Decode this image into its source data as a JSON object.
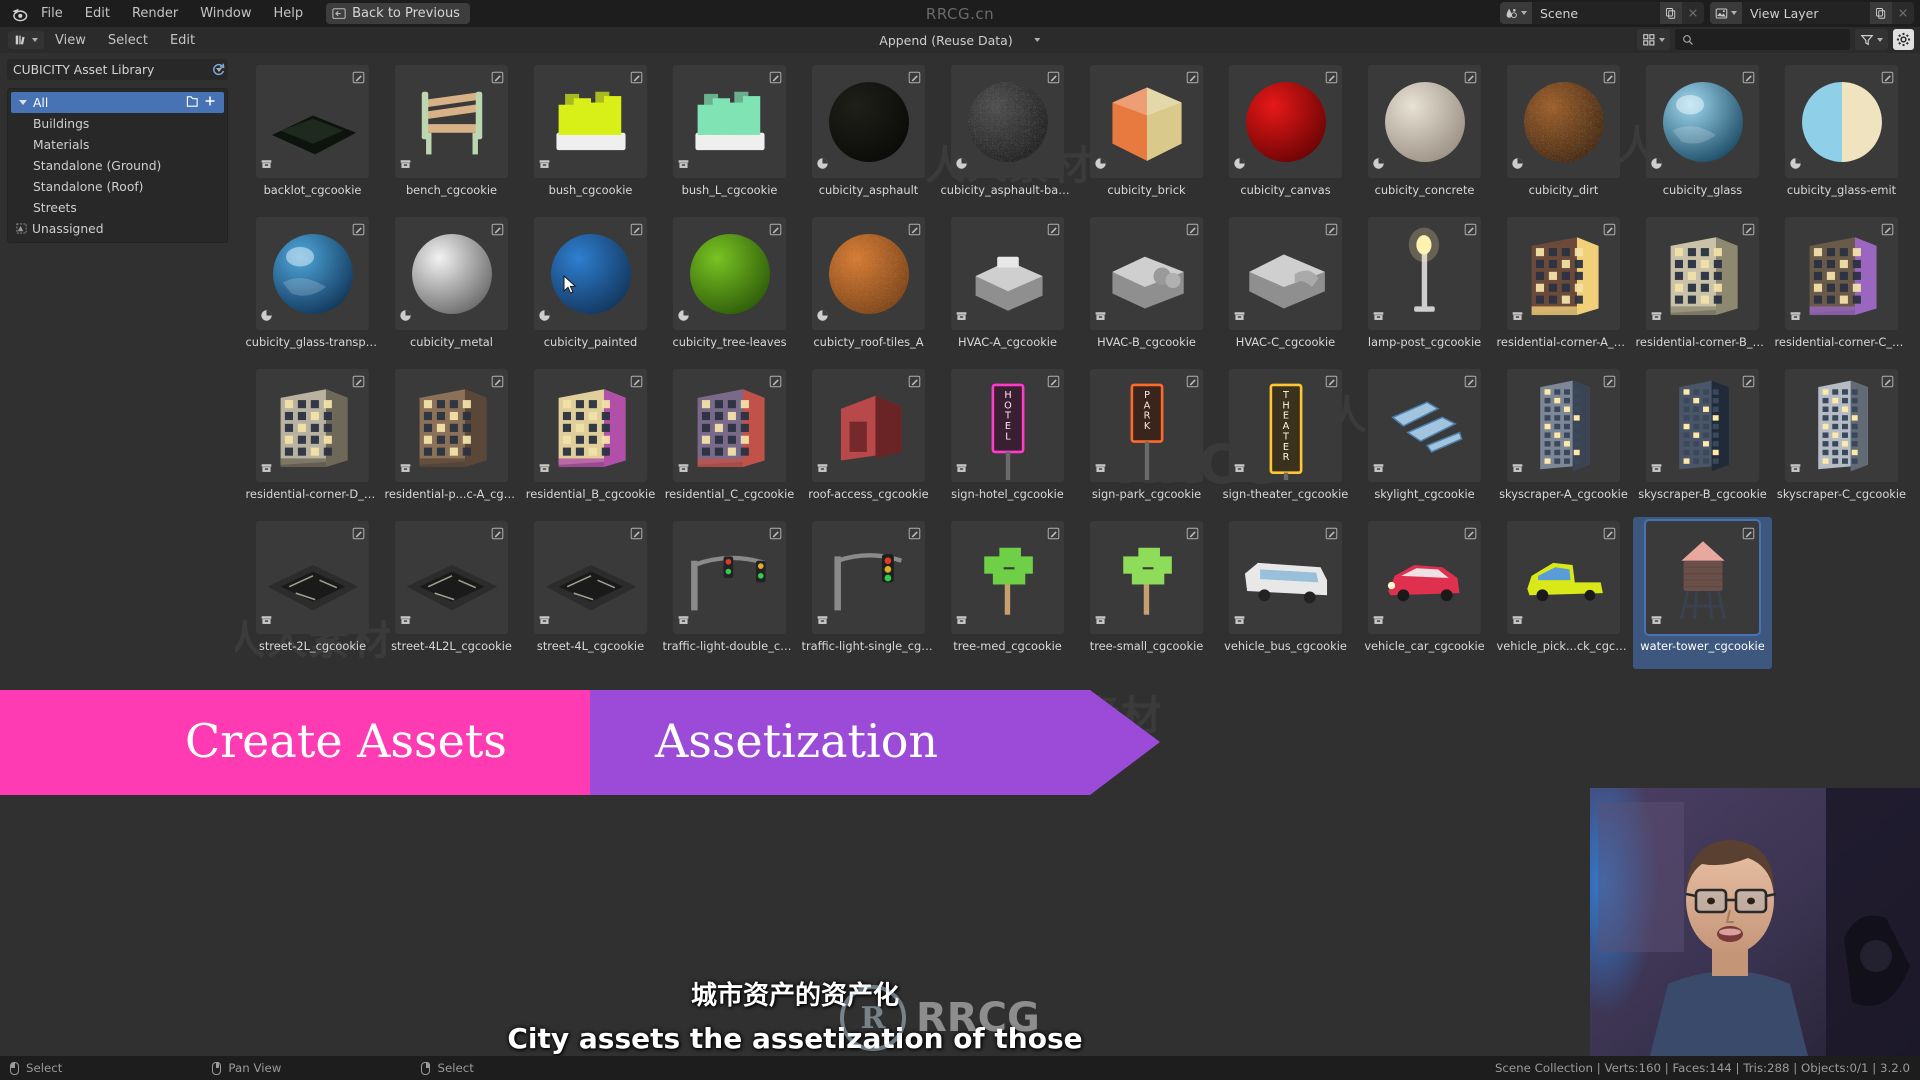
{
  "app": {
    "logo_icon": "blender-logo-icon",
    "menus": [
      "File",
      "Edit",
      "Render",
      "Window",
      "Help"
    ],
    "back_to_previous": "Back to Previous",
    "back_icon": "back-arrow-icon",
    "center_watermark": "RRCG.cn"
  },
  "topbar_right": {
    "scene_icon": "scene-icon",
    "scene_name": "Scene",
    "scene_new_icon": "new-datablock-icon",
    "scene_close_icon": "close-icon",
    "viewlayer_icon": "view-layer-icon",
    "viewlayer_name": "View Layer",
    "viewlayer_new_icon": "new-datablock-icon",
    "viewlayer_close_icon": "close-icon"
  },
  "editor_header": {
    "editor_type_icon": "asset-browser-icon",
    "menus": [
      "View",
      "Select",
      "Edit"
    ],
    "import_method": "Append (Reuse Data)",
    "display_mode_icon": "grid-display-icon",
    "search_icon": "search-icon",
    "search_value": "",
    "search_placeholder": "",
    "filter_icon": "filter-funnel-icon",
    "options_icon": "gear-icon"
  },
  "sidebar": {
    "library_label": "CUBICITY Asset Library",
    "refresh_icon": "refresh-icon",
    "categories": [
      {
        "label": "All",
        "selected": true,
        "indent": 0,
        "icon": "triangle-down-icon",
        "new_icon": "new-catalog-icon",
        "add_icon": "plus-icon"
      },
      {
        "label": "Buildings",
        "selected": false,
        "indent": 1,
        "icon": ""
      },
      {
        "label": "Materials",
        "selected": false,
        "indent": 1,
        "icon": ""
      },
      {
        "label": "Standalone (Ground)",
        "selected": false,
        "indent": 1,
        "icon": ""
      },
      {
        "label": "Standalone (Roof)",
        "selected": false,
        "indent": 1,
        "icon": ""
      },
      {
        "label": "Streets",
        "selected": false,
        "indent": 1,
        "icon": ""
      },
      {
        "label": "Unassigned",
        "selected": false,
        "indent": 1,
        "icon": "unassigned-icon"
      }
    ]
  },
  "assets": [
    {
      "name": "backlot_cgcookie",
      "kind": "object",
      "art": "ground-plane",
      "c1": "#243024",
      "c2": "#0d140d"
    },
    {
      "name": "bench_cgcookie",
      "kind": "object",
      "art": "bench",
      "c1": "#d9b187",
      "c2": "#bcd6b0"
    },
    {
      "name": "bush_cgcookie",
      "kind": "object",
      "art": "bush",
      "c1": "#d8f018",
      "c2": "#efefef"
    },
    {
      "name": "bush_L_cgcookie",
      "kind": "object",
      "art": "bush",
      "c1": "#7fe3b4",
      "c2": "#efefef"
    },
    {
      "name": "cubicity_asphault",
      "kind": "material",
      "art": "sphere",
      "c1": "#20201a",
      "c2": "#0a0a08"
    },
    {
      "name": "cubicity_asphault-backlot",
      "kind": "material",
      "art": "sphere-rough",
      "c1": "#4a4a4a",
      "c2": "#171717"
    },
    {
      "name": "cubicity_brick",
      "kind": "material",
      "art": "cube",
      "c1": "#e8793f",
      "c2": "#d9c98a"
    },
    {
      "name": "cubicity_canvas",
      "kind": "material",
      "art": "sphere",
      "c1": "#e81818",
      "c2": "#6a0404"
    },
    {
      "name": "cubicity_concrete",
      "kind": "material",
      "art": "sphere",
      "c1": "#e8e2d4",
      "c2": "#9b9184"
    },
    {
      "name": "cubicity_dirt",
      "kind": "material",
      "art": "sphere-rough",
      "c1": "#a05c22",
      "c2": "#3d2008"
    },
    {
      "name": "cubicity_glass",
      "kind": "material",
      "art": "sphere-glass",
      "c1": "#9fd8f0",
      "c2": "#14425c"
    },
    {
      "name": "cubicity_glass-emit",
      "kind": "material",
      "art": "sphere-split",
      "c1": "#8fd0e8",
      "c2": "#f0e4c0"
    },
    {
      "name": "cubicity_glass-transparent",
      "kind": "material",
      "art": "sphere-glass",
      "c1": "#4fa8dd",
      "c2": "#0d2f52"
    },
    {
      "name": "cubicity_metal",
      "kind": "material",
      "art": "sphere",
      "c1": "#f2f2f2",
      "c2": "#6a6a6a"
    },
    {
      "name": "cubicity_painted",
      "kind": "material",
      "art": "sphere",
      "c1": "#2f7fd0",
      "c2": "#12365e"
    },
    {
      "name": "cubicity_tree-leaves",
      "kind": "material",
      "art": "sphere",
      "c1": "#79c322",
      "c2": "#2e5c0a"
    },
    {
      "name": "cubicty_roof-tiles_A",
      "kind": "material",
      "art": "sphere-rough",
      "c1": "#e07b2a",
      "c2": "#7a3c0c"
    },
    {
      "name": "HVAC-A_cgcookie",
      "kind": "object",
      "art": "hvac-a",
      "c1": "#cfcfcf",
      "c2": "#8f8f8f"
    },
    {
      "name": "HVAC-B_cgcookie",
      "kind": "object",
      "art": "hvac-b",
      "c1": "#cfcfcf",
      "c2": "#8f8f8f"
    },
    {
      "name": "HVAC-C_cgcookie",
      "kind": "object",
      "art": "hvac-c",
      "c1": "#cfcfcf",
      "c2": "#8f8f8f"
    },
    {
      "name": "lamp-post_cgcookie",
      "kind": "object",
      "art": "lamppost",
      "c1": "#cfcfcf",
      "c2": "#fff1b0"
    },
    {
      "name": "residential-corner-A_cgco...",
      "kind": "object",
      "art": "building",
      "c1": "#6b4a3a",
      "c2": "#f2d07a"
    },
    {
      "name": "residential-corner-B_cgco...",
      "kind": "object",
      "art": "building",
      "c1": "#c9c2a8",
      "c2": "#8e8870"
    },
    {
      "name": "residential-corner-C_cgco...",
      "kind": "object",
      "art": "building",
      "c1": "#6a5a4a",
      "c2": "#9a66c0"
    },
    {
      "name": "residential-corner-D_cgco...",
      "kind": "object",
      "art": "building",
      "c1": "#b9b2a0",
      "c2": "#6e6858"
    },
    {
      "name": "residential-p...c-A_cgcookie",
      "kind": "object",
      "art": "building",
      "c1": "#8a7158",
      "c2": "#5a4738"
    },
    {
      "name": "residential_B_cgcookie",
      "kind": "object",
      "art": "building",
      "c1": "#e0cf9a",
      "c2": "#b24fa8"
    },
    {
      "name": "residential_C_cgcookie",
      "kind": "object",
      "art": "building",
      "c1": "#7a6a8a",
      "c2": "#c0524a"
    },
    {
      "name": "roof-access_cgcookie",
      "kind": "object",
      "art": "roofaccess",
      "c1": "#b8484a",
      "c2": "#6a2426"
    },
    {
      "name": "sign-hotel_cgcookie",
      "kind": "object",
      "art": "sign",
      "c1": "#ff3cc8",
      "c2": "#ff8ae0",
      "sign_text": "HOTEL"
    },
    {
      "name": "sign-park_cgcookie",
      "kind": "object",
      "art": "sign",
      "c1": "#ff6a2a",
      "c2": "#ffb070",
      "sign_text": "PARK"
    },
    {
      "name": "sign-theater_cgcookie",
      "kind": "object",
      "art": "sign",
      "c1": "#ffc832",
      "c2": "#ffe08a",
      "sign_text": "THEATER"
    },
    {
      "name": "skylight_cgcookie",
      "kind": "object",
      "art": "skylight",
      "c1": "#aed4f0",
      "c2": "#4a86b8"
    },
    {
      "name": "skyscraper-A_cgcookie",
      "kind": "object",
      "art": "skyscraper",
      "c1": "#7d8796",
      "c2": "#3a4452"
    },
    {
      "name": "skyscraper-B_cgcookie",
      "kind": "object",
      "art": "skyscraper",
      "c1": "#4a5668",
      "c2": "#202a38"
    },
    {
      "name": "skyscraper-C_cgcookie",
      "kind": "object",
      "art": "skyscraper",
      "c1": "#b6bcc4",
      "c2": "#626a76"
    },
    {
      "name": "street-2L_cgcookie",
      "kind": "object",
      "art": "street",
      "c1": "#2c2c2c",
      "c2": "#1a1a1a"
    },
    {
      "name": "street-4L2L_cgcookie",
      "kind": "object",
      "art": "street",
      "c1": "#2c2c2c",
      "c2": "#1a1a1a"
    },
    {
      "name": "street-4L_cgcookie",
      "kind": "object",
      "art": "street",
      "c1": "#2c2c2c",
      "c2": "#1a1a1a"
    },
    {
      "name": "traffic-light-double_cgcoo...",
      "kind": "object",
      "art": "traffic-double",
      "c1": "#8a8a8a",
      "c2": "#2fcc50"
    },
    {
      "name": "traffic-light-single_cgcooki",
      "kind": "object",
      "art": "traffic-single",
      "c1": "#8a8a8a",
      "c2": "#e03a2a"
    },
    {
      "name": "tree-med_cgcookie",
      "kind": "object",
      "art": "tree",
      "c1": "#6fd048",
      "c2": "#c8a070"
    },
    {
      "name": "tree-small_cgcookie",
      "kind": "object",
      "art": "tree",
      "c1": "#8fdc5a",
      "c2": "#c8a070"
    },
    {
      "name": "vehicle_bus_cgcookie",
      "kind": "object",
      "art": "bus",
      "c1": "#e8e8e8",
      "c2": "#8ab8d8"
    },
    {
      "name": "vehicle_car_cgcookie",
      "kind": "object",
      "art": "car",
      "c1": "#e03050",
      "c2": "#f0f0f0"
    },
    {
      "name": "vehicle_pick...ck_cgcookie",
      "kind": "object",
      "art": "truck",
      "c1": "#d8e818",
      "c2": "#5a9cd8"
    },
    {
      "name": "water-tower_cgcookie",
      "kind": "object",
      "art": "watertower",
      "c1": "#e8a8a0",
      "c2": "#6a5048",
      "selected": true
    }
  ],
  "banner": {
    "text_left": "Create Assets",
    "text_right": "Assetization",
    "color_left": "#ff3bb4",
    "color_right": "#9b4bd8"
  },
  "subtitles": {
    "chinese": "城市资产的资产化",
    "english": "City assets the assetization of those"
  },
  "watermarks": {
    "logo_text": "RRCG",
    "logo_mark": "R",
    "tiles": [
      "人人素材",
      "人人素材",
      "人人素材",
      "人人素材",
      "人人素材",
      "人人素材"
    ]
  },
  "status_bar": {
    "left_items": [
      {
        "label": "Select",
        "mouse": "left"
      },
      {
        "label": "Pan View",
        "mouse": "middle"
      },
      {
        "label": "Select",
        "mouse": "right"
      }
    ],
    "right_text": "Scene Collection | Verts:160 | Faces:144 | Tris:288 | Objects:0/1 | 3.2.0"
  }
}
